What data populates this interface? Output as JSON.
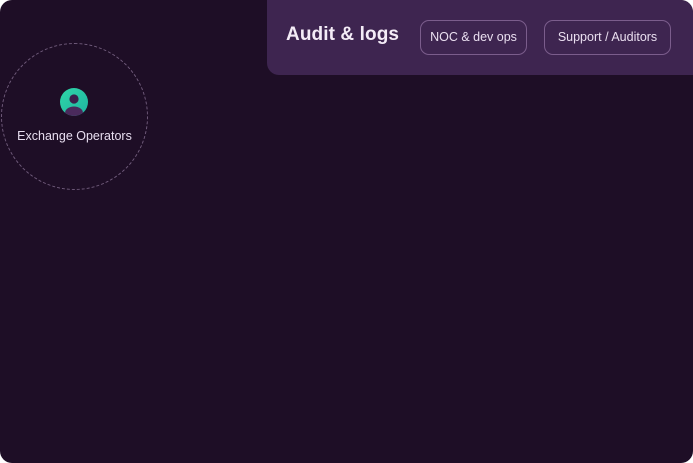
{
  "header": {
    "title": "Audit & logs",
    "chips": [
      {
        "label": "NOC & dev ops"
      },
      {
        "label": "Support / Auditors"
      }
    ]
  },
  "role": {
    "label": "Exchange Operators",
    "icon": "user-avatar-icon"
  },
  "colors": {
    "background": "#1e0e26",
    "panel": "#3e2550",
    "accent": "#23c9a0"
  }
}
